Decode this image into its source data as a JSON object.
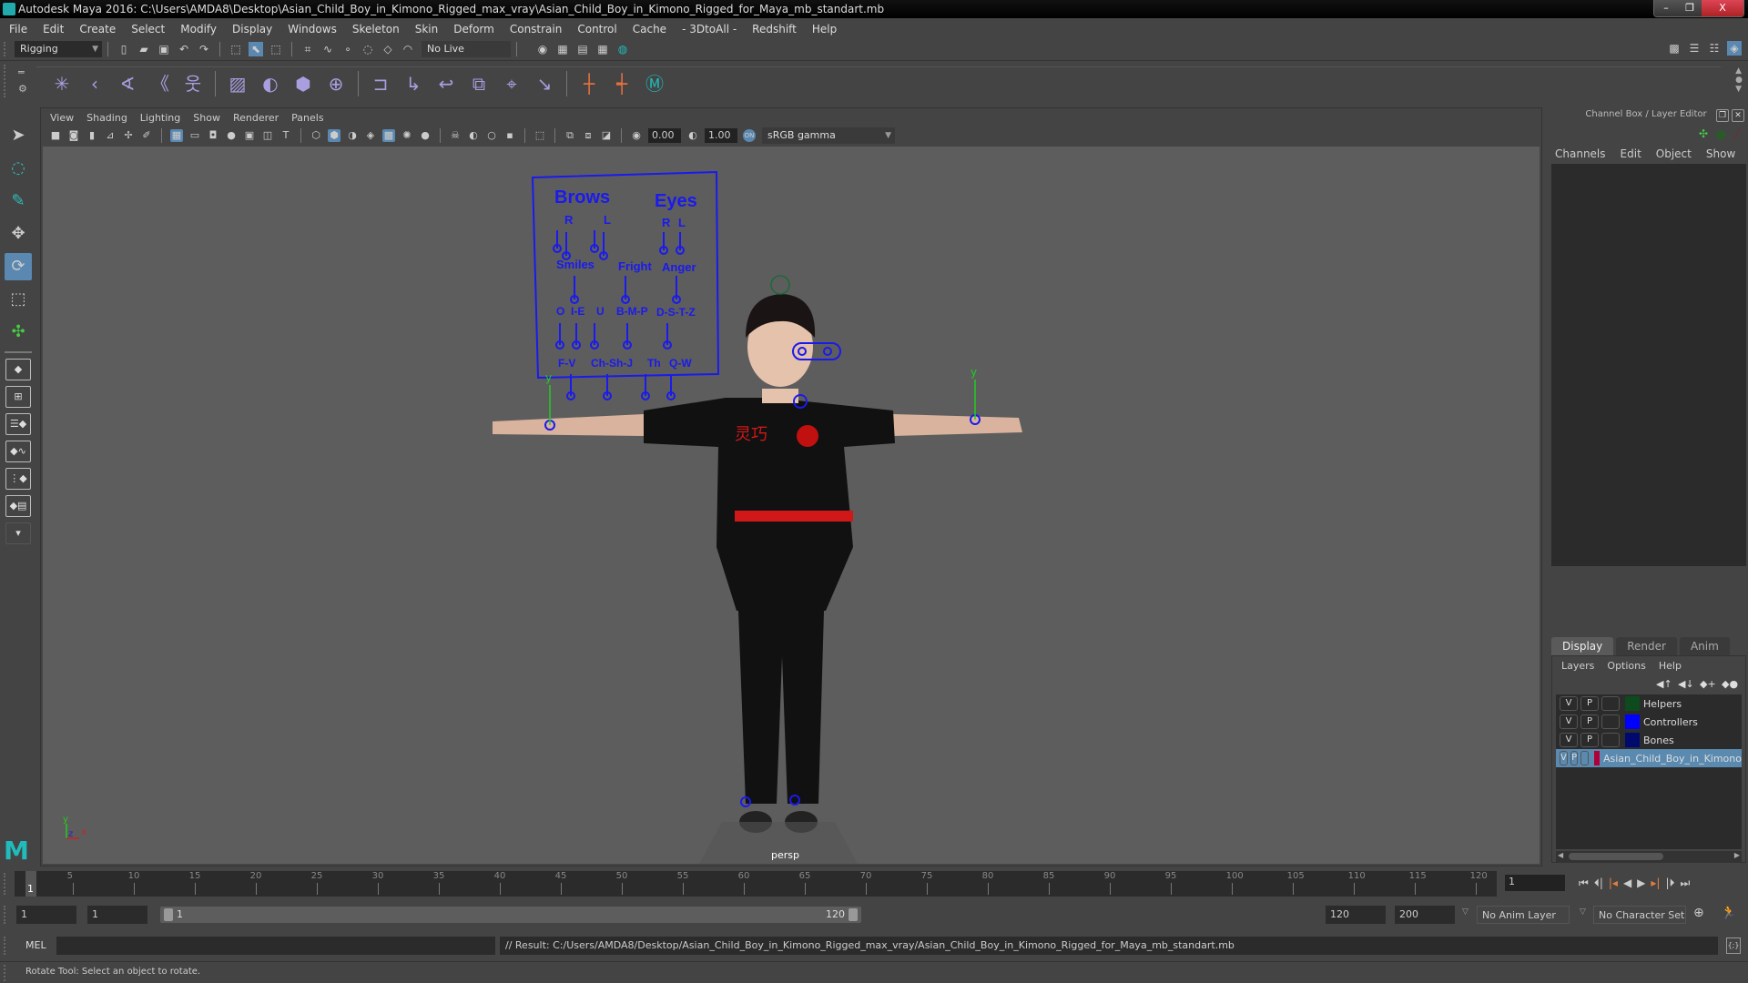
{
  "window": {
    "title": "Autodesk Maya 2016: C:\\Users\\AMDA8\\Desktop\\Asian_Child_Boy_in_Kimono_Rigged_max_vray\\Asian_Child_Boy_in_Kimono_Rigged_for_Maya_mb_standart.mb",
    "buttons": {
      "minimize": "–",
      "restore": "❐",
      "close": "X"
    }
  },
  "menubar": [
    "File",
    "Edit",
    "Create",
    "Select",
    "Modify",
    "Display",
    "Windows",
    "Skeleton",
    "Skin",
    "Deform",
    "Constrain",
    "Control",
    "Cache",
    "- 3DtoAll -",
    "Redshift",
    "Help"
  ],
  "statusline": {
    "menuset": "Rigging",
    "live_surface": "No Live Surface"
  },
  "shelf": {
    "icons": [
      "joint-tool-icon",
      "ik-handle-icon",
      "ik-spline-icon",
      "insert-joint-icon",
      "humanik-icon",
      "paint-skin-weights-icon",
      "blend-shape-icon",
      "lattice-icon",
      "cluster-icon",
      "parent-constraint-icon",
      "point-constraint-icon",
      "orient-constraint-icon",
      "scale-constraint-icon",
      "aim-constraint-icon",
      "pole-vector-icon",
      "locator-icon",
      "locator-constraint-icon",
      "maya-m-icon"
    ]
  },
  "toolbox": [
    "select-tool",
    "lasso-tool",
    "paint-select-tool",
    "move-tool",
    "rotate-tool",
    "scale-tool",
    "universal-manipulator",
    "single-perspective-layout",
    "four-view-layout",
    "persp-outliner-layout",
    "persp-graph-layout",
    "hypershade-persp-layout",
    "persp-graph-outliner-layout",
    "more-layouts"
  ],
  "viewport": {
    "menu": [
      "View",
      "Shading",
      "Lighting",
      "Show",
      "Renderer",
      "Panels"
    ],
    "exposure": "0.00",
    "gamma": "1.00",
    "color_space": "sRGB gamma",
    "camera_label": "persp",
    "face_controls": {
      "headers": [
        "Brows",
        "Eyes"
      ],
      "brow_sides": [
        "R",
        "L"
      ],
      "eye_sides": [
        "R",
        "L"
      ],
      "row2": [
        "Smiles",
        "Fright",
        "Anger"
      ],
      "row3": [
        "O",
        "I-E",
        "U",
        "B-M-P",
        "D-S-T-Z"
      ],
      "row4": [
        "F-V",
        "Ch-Sh-J",
        "Th",
        "Q-W"
      ]
    },
    "axis": {
      "y": "y",
      "z": "z",
      "x": "x"
    }
  },
  "channel_box": {
    "title": "Channel Box / Layer Editor",
    "menu": [
      "Channels",
      "Edit",
      "Object",
      "Show"
    ]
  },
  "layer_editor": {
    "tabs": [
      "Display",
      "Render",
      "Anim"
    ],
    "selected_tab": "Display",
    "menu": [
      "Layers",
      "Options",
      "Help"
    ],
    "layers": [
      {
        "v": "V",
        "p": "P",
        "color": "#0d4a1e",
        "name": "Helpers",
        "selected": false
      },
      {
        "v": "V",
        "p": "P",
        "color": "#0000ff",
        "name": "Controllers",
        "selected": false
      },
      {
        "v": "V",
        "p": "P",
        "color": "#000a6e",
        "name": "Bones",
        "selected": false
      },
      {
        "v": "V",
        "p": "P",
        "color": "#b0003a",
        "name": "Asian_Child_Boy_in_Kimono",
        "selected": true
      }
    ]
  },
  "timeline": {
    "ticks": [
      "5",
      "10",
      "15",
      "20",
      "25",
      "30",
      "35",
      "40",
      "45",
      "50",
      "55",
      "60",
      "65",
      "70",
      "75",
      "80",
      "85",
      "90",
      "95",
      "100",
      "105",
      "110",
      "115",
      "120"
    ],
    "current_frame": "1",
    "current_frame_field": "1"
  },
  "range": {
    "start": "1",
    "playback_start": "1",
    "slider_start": "1",
    "slider_end": "120",
    "playback_end": "120",
    "end": "200",
    "anim_layer": "No Anim Layer",
    "character_set": "No Character Set"
  },
  "command_line": {
    "label": "MEL",
    "input": "",
    "result": "// Result: C:/Users/AMDA8/Desktop/Asian_Child_Boy_in_Kimono_Rigged_max_vray/Asian_Child_Boy_in_Kimono_Rigged_for_Maya_mb_standart.mb"
  },
  "help_line": "Rotate Tool: Select an object to rotate."
}
